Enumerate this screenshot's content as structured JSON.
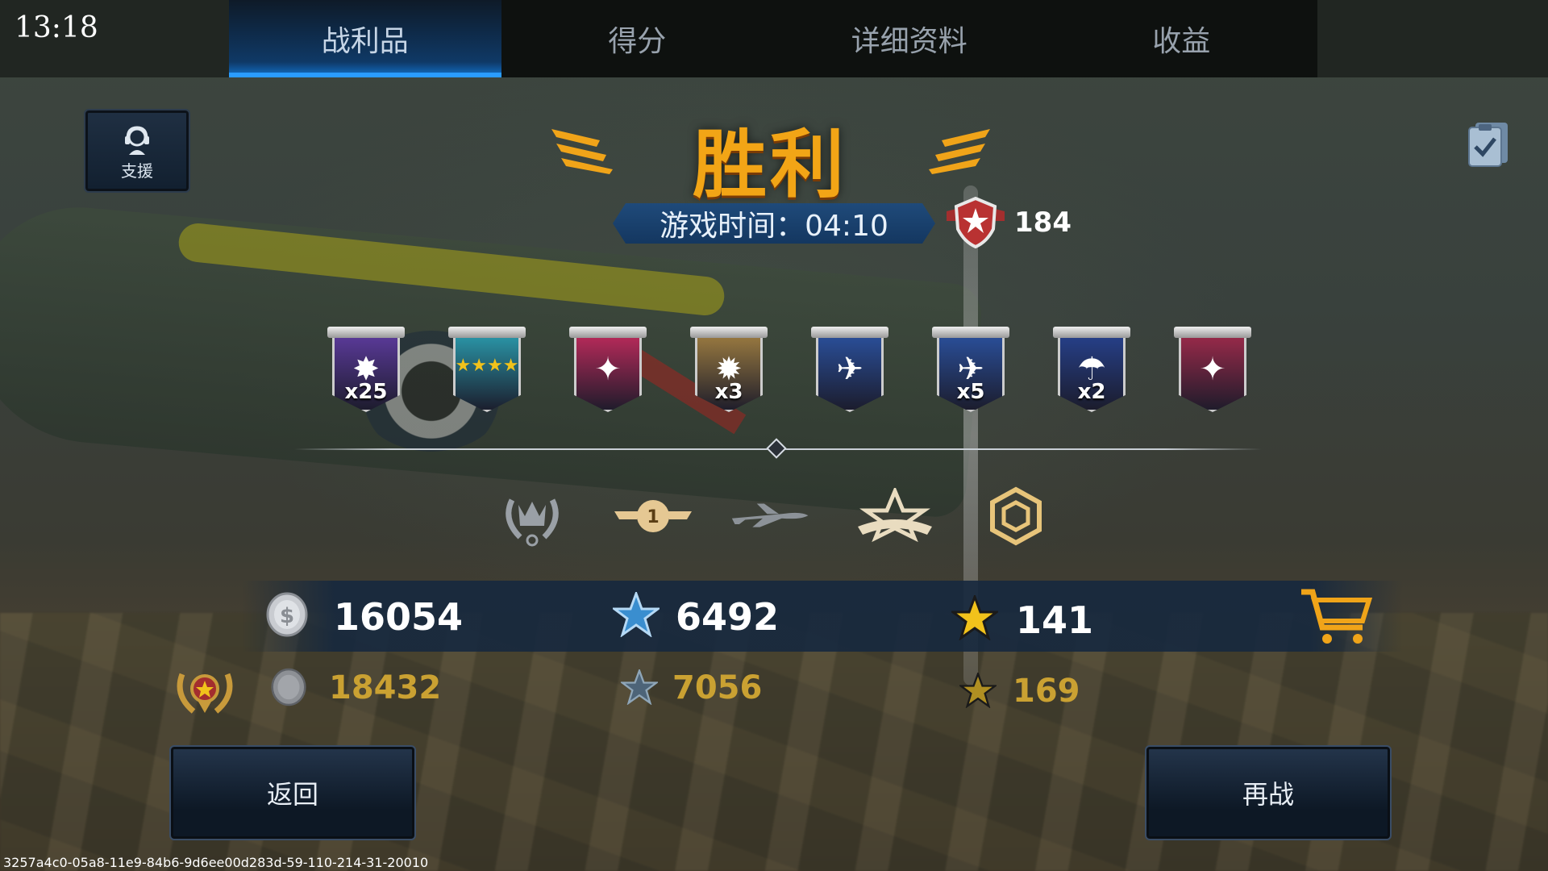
{
  "status_bar": {
    "time": "13:18"
  },
  "tabs": [
    {
      "label": "战利品",
      "active": true
    },
    {
      "label": "得分",
      "active": false
    },
    {
      "label": "详细资料",
      "active": false
    },
    {
      "label": "收益",
      "active": false
    }
  ],
  "support": {
    "label": "支援",
    "icon": "pilot-headset-icon"
  },
  "header": {
    "title": "胜利",
    "time_label": "游戏时间：04:10",
    "rank_score": "184"
  },
  "medals": [
    {
      "name": "explosion-medal",
      "count": "x25",
      "color": "#5b3a9a"
    },
    {
      "name": "four-star-medal",
      "count": "",
      "color": "#2a96a8"
    },
    {
      "name": "star-cross-medal",
      "count": "",
      "color": "#b82a5a"
    },
    {
      "name": "bomb-medal",
      "count": "x3",
      "color": "#9a7a40"
    },
    {
      "name": "fighter-plane-medal",
      "count": "",
      "color": "#2a4f9a"
    },
    {
      "name": "fighter-plane-multi-medal",
      "count": "x5",
      "color": "#2a4f9a"
    },
    {
      "name": "parachute-medal",
      "count": "x2",
      "color": "#26408a"
    },
    {
      "name": "blood-star-medal",
      "count": "",
      "color": "#9a2a4a"
    }
  ],
  "rewards": {
    "silver": "16054",
    "xp": "6492",
    "gold": "141"
  },
  "premium_rewards": {
    "silver": "18432",
    "xp": "7056",
    "gold": "169"
  },
  "buttons": {
    "back": "返回",
    "rematch": "再战"
  },
  "session_id": "3257a4c0-05a8-11e9-84b6-9d6ee00d283d-59-110-214-31-20010"
}
